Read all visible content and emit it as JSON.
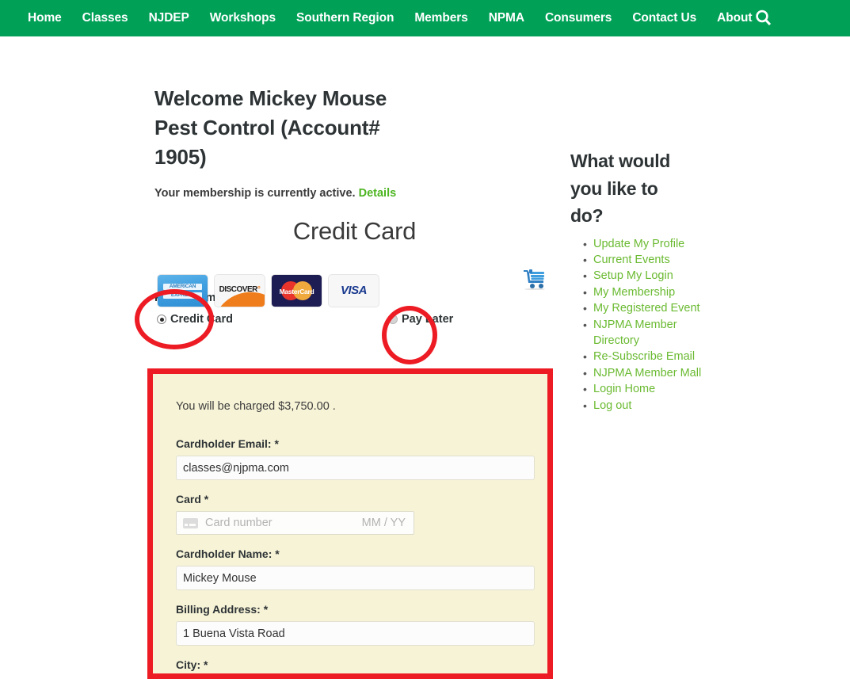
{
  "nav": {
    "items": [
      {
        "label": "Home"
      },
      {
        "label": "Classes"
      },
      {
        "label": "NJDEP"
      },
      {
        "label": "Workshops"
      },
      {
        "label": "Southern Region"
      },
      {
        "label": "Members"
      },
      {
        "label": "NPMA"
      },
      {
        "label": "Consumers"
      },
      {
        "label": "Contact Us"
      },
      {
        "label": "About"
      }
    ],
    "search_icon": "search-icon",
    "background_color": "#00a157",
    "text_color": "#ffffff"
  },
  "main": {
    "welcome_title": "Welcome Mickey Mouse Pest Control (Account# 1905)",
    "membership_status": "Your membership is currently active.",
    "details_link": "Details",
    "details_link_color": "#4cb520",
    "page_heading": "Credit Card",
    "cart_icon": "shopping-cart-icon"
  },
  "payment_method": {
    "label": "Payment method:",
    "options": [
      {
        "label": "Credit Card",
        "selected": true
      },
      {
        "label": "Pay Later",
        "selected": false
      }
    ],
    "card_logos": [
      {
        "name": "amex-logo",
        "line1": "AMERICAN",
        "line2": "EXPRESS"
      },
      {
        "name": "discover-logo",
        "text": "DISCOVER",
        "trailing": "°"
      },
      {
        "name": "mastercard-logo",
        "text": "MasterCard"
      },
      {
        "name": "visa-logo",
        "text": "VISA"
      }
    ]
  },
  "credit_card_form": {
    "charge_notice": "You will be charged $3,750.00 .",
    "border_color": "#ed1c24",
    "background_color": "#f7f3d7",
    "fields": [
      {
        "name": "cardholder-email",
        "label": "Cardholder Email: *",
        "value": "classes@njpma.com",
        "placeholder": ""
      },
      {
        "name": "card",
        "label": "Card *",
        "card_number_placeholder": "Card number",
        "expiry_placeholder": "MM / YY",
        "card_icon": "credit-card-icon"
      },
      {
        "name": "cardholder-name",
        "label": "Cardholder Name: *",
        "value": "Mickey Mouse",
        "placeholder": ""
      },
      {
        "name": "billing-address",
        "label": "Billing Address: *",
        "value": "1 Buena Vista Road",
        "placeholder": ""
      },
      {
        "name": "city",
        "label": "City: *",
        "value": "",
        "placeholder": ""
      }
    ]
  },
  "sidebar": {
    "title": "What would you like to do?",
    "link_color": "#6aba31",
    "items": [
      {
        "label": "Update My Profile"
      },
      {
        "label": "Current Events"
      },
      {
        "label": "Setup My Login"
      },
      {
        "label": "My Membership"
      },
      {
        "label": "My Registered Event"
      },
      {
        "label": "NJPMA Member Directory"
      },
      {
        "label": "Re-Subscribe Email"
      },
      {
        "label": "NJPMA Member Mall"
      },
      {
        "label": "Login Home"
      },
      {
        "label": "Log out"
      }
    ]
  },
  "annotations": {
    "color": "#ed1c24",
    "shapes": [
      "ellipse-credit-card-radio",
      "ellipse-pay-later-radio",
      "rectangle-credit-card-form"
    ]
  }
}
